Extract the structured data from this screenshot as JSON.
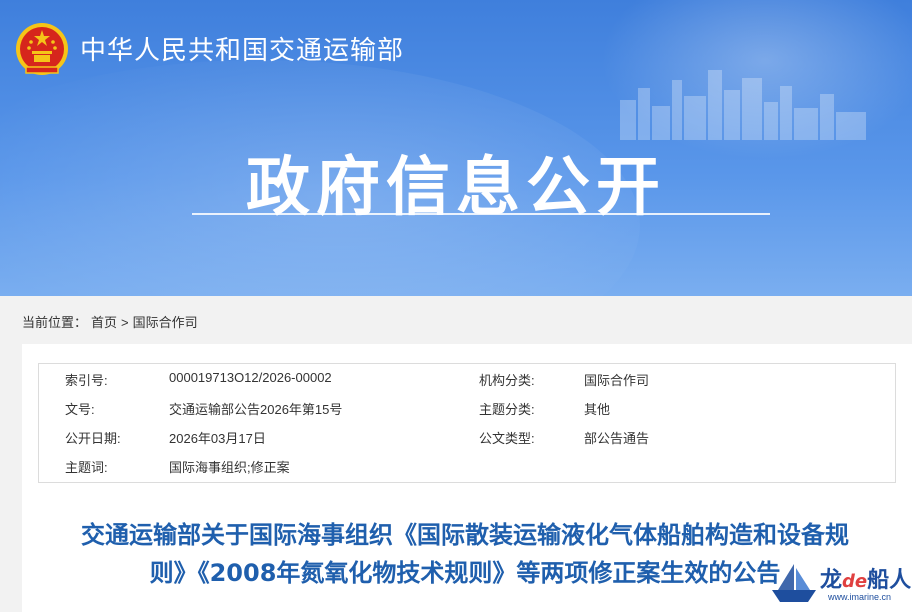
{
  "header": {
    "ministry_name": "中华人民共和国交通运输部",
    "section_title": "政府信息公开"
  },
  "breadcrumb": {
    "label": "当前位置：",
    "home": "首页",
    "separator": ">",
    "current": "国际合作司"
  },
  "meta": {
    "index_label": "索引号:",
    "index_value": "000019713O12/2026-00002",
    "org_label": "机构分类:",
    "org_value": "国际合作司",
    "docno_label": "文号:",
    "docno_value": "交通运输部公告2026年第15号",
    "topic_label": "主题分类:",
    "topic_value": "其他",
    "date_label": "公开日期:",
    "date_value": "2026年03月17日",
    "type_label": "公文类型:",
    "type_value": "部公告通告",
    "keywords_label": "主题词:",
    "keywords_value": "国际海事组织;修正案"
  },
  "document": {
    "title_line1": "交通运输部关于国际海事组织《国际散装运输液化气体船舶构造和设备规",
    "title_line2": "则》《2008年氮氧化物技术规则》等两项修正案生效的公告"
  },
  "watermark": {
    "brand_a": "龙",
    "brand_de": "de",
    "brand_b": "船人",
    "url": "www.imarine.cn"
  },
  "colors": {
    "banner": "#4a8ae4",
    "title_blue": "#1f5fad",
    "emblem_red": "#d6261c",
    "emblem_gold": "#f5c518"
  }
}
